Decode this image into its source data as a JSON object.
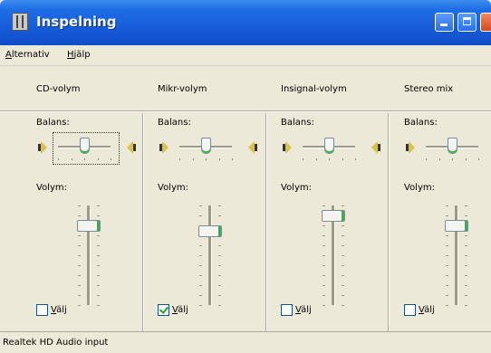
{
  "window": {
    "title": "Inspelning",
    "icon": "mixer-icon"
  },
  "menu": [
    {
      "label_acc": "A",
      "label_rest": "lternativ"
    },
    {
      "label_acc": "H",
      "label_rest": "jälp"
    }
  ],
  "channels": [
    {
      "name": "CD-volym",
      "balance_label": "Balans:",
      "volume_label": "Volym:",
      "select_acc": "V",
      "select_rest": "älj",
      "selected": false,
      "balance": 0.5,
      "volume": 0.8
    },
    {
      "name": "Mikr-volym",
      "balance_label": "Balans:",
      "volume_label": "Volym:",
      "select_acc": "V",
      "select_rest": "älj",
      "selected": true,
      "balance": 0.5,
      "volume": 0.75
    },
    {
      "name": "Insignal-volym",
      "balance_label": "Balans:",
      "volume_label": "Volym:",
      "select_acc": "V",
      "select_rest": "älj",
      "selected": false,
      "balance": 0.5,
      "volume": 0.9
    },
    {
      "name": "Stereo mix",
      "balance_label": "Balans:",
      "volume_label": "Volym:",
      "select_acc": "V",
      "select_rest": "älj",
      "selected": false,
      "balance": 0.5,
      "volume": 0.8
    }
  ],
  "status": "Realtek HD Audio input",
  "colors": {
    "titlebar": "#1558d6",
    "window_bg": "#ece9d8",
    "slider_accent": "#31b83b"
  }
}
